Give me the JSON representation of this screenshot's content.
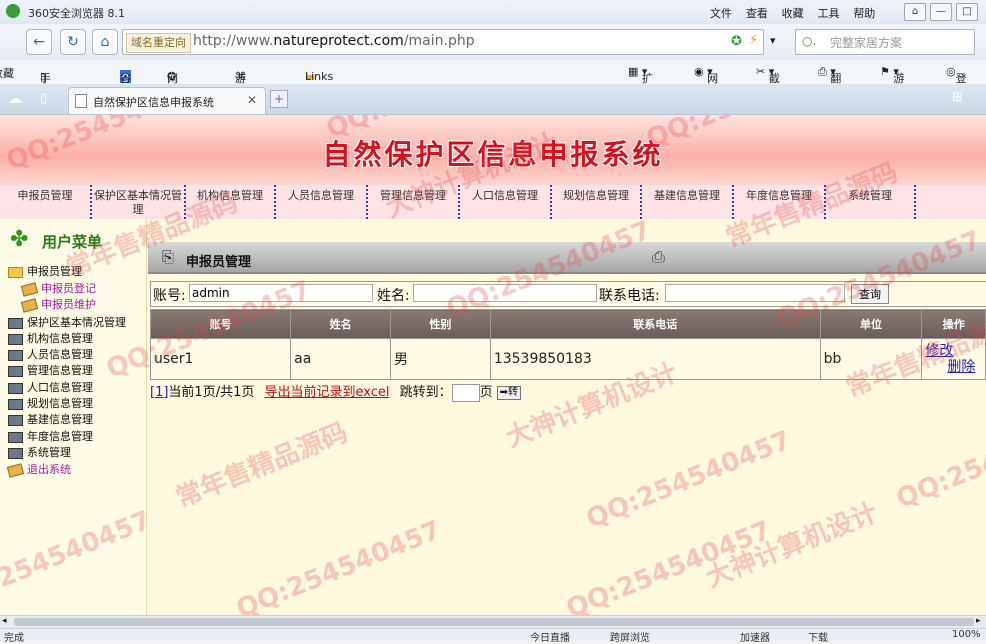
{
  "browser": {
    "title": "360安全浏览器 8.1",
    "menu": [
      "文件",
      "查看",
      "收藏",
      "工具",
      "帮助"
    ],
    "redirect_label": "域名重定向",
    "url_prefix": "http://www.",
    "url_domain": "natureprotect.com",
    "url_path": "/main.php",
    "search_placeholder": "完整家居方案",
    "bookmarks_left": [
      "收藏",
      "手机收藏夹",
      "谷歌",
      "网址大全",
      "游戏中心",
      "Links"
    ],
    "bookmarks_right": [
      "扩展",
      "网银",
      "截图",
      "翻译",
      "游戏",
      "登录"
    ],
    "tab_title": "自然保护区信息申报系统",
    "status_left": "完成",
    "status_items": [
      "今日直播",
      "跨屏浏览",
      "加速器",
      "下载",
      "100%"
    ]
  },
  "page": {
    "banner_title": "自然保护区信息申报系统",
    "topnav": [
      "申报员管理",
      "保护区基本情况管理",
      "机构信息管理",
      "人员信息管理",
      "管理信息管理",
      "人口信息管理",
      "规划信息管理",
      "基建信息管理",
      "年度信息管理",
      "系统管理"
    ],
    "sidebar": {
      "header": "用户菜单",
      "items": [
        {
          "label": "申报员管理",
          "type": "folder"
        },
        {
          "label": "申报员登记",
          "type": "sub"
        },
        {
          "label": "申报员维护",
          "type": "sub"
        },
        {
          "label": "保护区基本情况管理",
          "type": "book"
        },
        {
          "label": "机构信息管理",
          "type": "book"
        },
        {
          "label": "人员信息管理",
          "type": "book"
        },
        {
          "label": "管理信息管理",
          "type": "book"
        },
        {
          "label": "人口信息管理",
          "type": "book"
        },
        {
          "label": "规划信息管理",
          "type": "book"
        },
        {
          "label": "基建信息管理",
          "type": "book"
        },
        {
          "label": "年度信息管理",
          "type": "book"
        },
        {
          "label": "系统管理",
          "type": "book"
        },
        {
          "label": "退出系统",
          "type": "exit"
        }
      ]
    },
    "panel_title": "申报员管理",
    "search": {
      "account_label": "账号:",
      "account_value": "admin",
      "name_label": "姓名:",
      "name_value": "",
      "phone_label": "联系电话:",
      "phone_value": "",
      "button": "查询"
    },
    "table": {
      "headers": [
        "账号",
        "姓名",
        "性别",
        "联系电话",
        "单位",
        "操作"
      ],
      "rows": [
        {
          "account": "user1",
          "name": "aa",
          "gender": "男",
          "phone": "13539850183",
          "unit": "bb",
          "edit": "修改",
          "delete": "删除"
        }
      ]
    },
    "pager": {
      "page_link": "[1]",
      "info": "当前1页/共1页",
      "export": "导出当前记录到excel",
      "jump_label": "跳转到：",
      "page_unit": "页",
      "go_label": "➡转"
    },
    "watermarks": [
      "QQ:254540457",
      "常年售精品源码",
      "大神计算机设计"
    ]
  }
}
